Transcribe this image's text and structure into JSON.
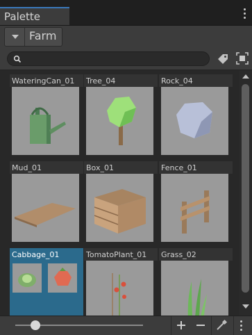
{
  "window": {
    "tab_title": "Palette"
  },
  "toolbar": {
    "palette_selected": "Farm"
  },
  "search": {
    "value": "",
    "placeholder": ""
  },
  "tiles": [
    {
      "label": "WateringCan_01",
      "icon": "watering-can"
    },
    {
      "label": "Tree_04",
      "icon": "tree"
    },
    {
      "label": "Rock_04",
      "icon": "rock"
    },
    {
      "label": "Mud_01",
      "icon": "mud-patch"
    },
    {
      "label": "Box_01",
      "icon": "wooden-crate"
    },
    {
      "label": "Fence_01",
      "icon": "fence"
    },
    {
      "label": "Cabbage_01",
      "icon": "cabbage",
      "selected": true,
      "variants": [
        "cabbage",
        "tomato"
      ]
    },
    {
      "label": "TomatoPlant_01",
      "icon": "tomato-plant"
    },
    {
      "label": "Grass_02",
      "icon": "grass"
    }
  ],
  "footer": {
    "zoom_level": 0.15
  },
  "colors": {
    "accent": "#3a79bb",
    "selection": "#2b6a8c",
    "preview_bg": "#9a9a9a",
    "panel": "#3c3c3c"
  }
}
